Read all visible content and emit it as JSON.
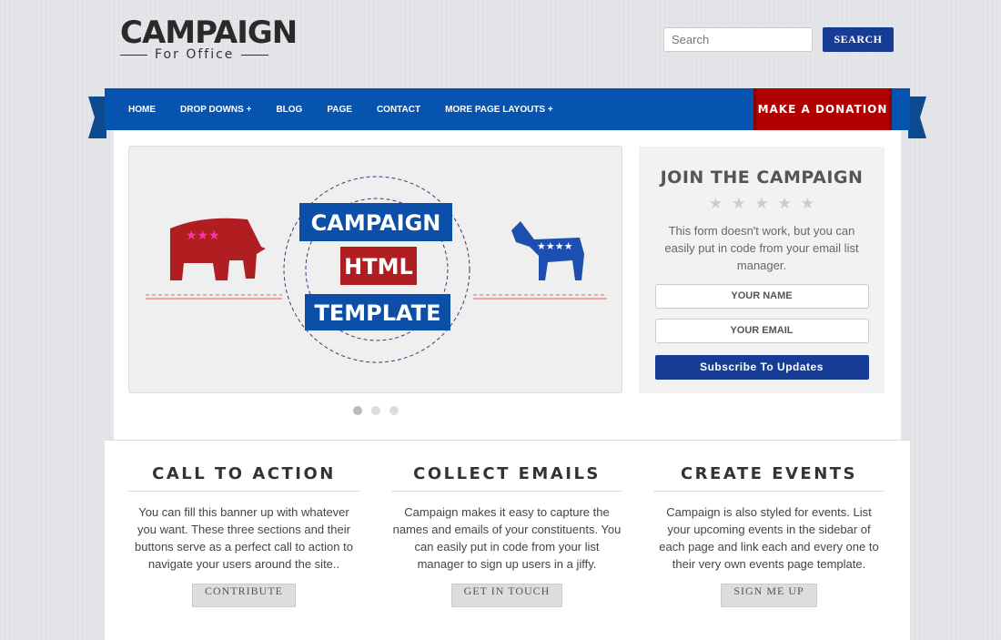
{
  "logo": {
    "title": "CAMPAIGN",
    "subtitle": "For Office"
  },
  "search": {
    "placeholder": "Search",
    "button": "SEARCH"
  },
  "nav": {
    "items": [
      "HOME",
      "DROP DOWNS +",
      "BLOG",
      "PAGE",
      "CONTACT",
      "MORE PAGE LAYOUTS +"
    ],
    "donate": "MAKE A DONATION"
  },
  "slider": {
    "line1": "CAMPAIGN",
    "line2": "HTML",
    "line3": "TEMPLATE",
    "slides": 3,
    "active": 1
  },
  "signup": {
    "title": "JOIN THE CAMPAIGN",
    "stars": "★★★★★",
    "text": "This form doesn't work, but you can easily put in code from your email list manager.",
    "name_placeholder": "YOUR NAME",
    "email_placeholder": "YOUR EMAIL",
    "button": "Subscribe To Updates"
  },
  "features": [
    {
      "title": "CALL TO ACTION",
      "text": "You can fill this banner up with whatever you want. These three sections and their buttons serve as a perfect call to action to navigate your users around the site..",
      "button": "CONTRIBUTE"
    },
    {
      "title": "COLLECT EMAILS",
      "text": "Campaign makes it easy to capture the names and emails of your constituents. You can easily put in code from your list manager to sign up users in a jiffy.",
      "button": "GET IN TOUCH"
    },
    {
      "title": "CREATE EVENTS",
      "text": "Campaign is also styled for events. List your upcoming events in the sidebar of each page and link each and every one to their very own events page template.",
      "button": "SIGN ME UP"
    }
  ],
  "colors": {
    "nav": "#0654b0",
    "donate": "#b00000",
    "button": "#163c96"
  }
}
